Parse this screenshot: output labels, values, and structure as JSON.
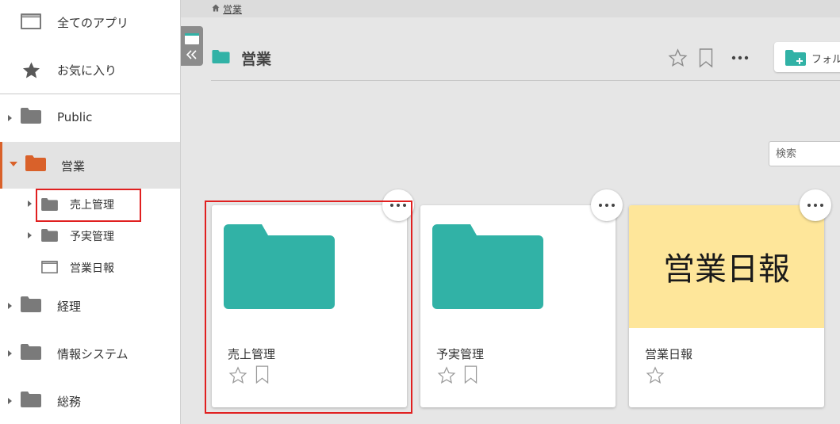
{
  "sidebar": {
    "items": [
      {
        "label": "全てのアプリ",
        "icon": "app-window-icon"
      },
      {
        "label": "お気に入り",
        "icon": "star-icon"
      },
      {
        "label": "Public",
        "icon": "folder-icon"
      },
      {
        "label": "営業",
        "icon": "folder-icon",
        "selected": true
      },
      {
        "label": "売上管理",
        "icon": "folder-icon"
      },
      {
        "label": "予実管理",
        "icon": "folder-icon"
      },
      {
        "label": "営業日報",
        "icon": "app-window-icon"
      },
      {
        "label": "経理",
        "icon": "folder-icon"
      },
      {
        "label": "情報システム",
        "icon": "folder-icon"
      },
      {
        "label": "総務",
        "icon": "folder-icon"
      }
    ]
  },
  "breadcrumb": {
    "home_icon": "home-icon",
    "current": "営業"
  },
  "header": {
    "title": "営業",
    "new_folder_label": "フォルダ"
  },
  "search": {
    "placeholder": "検索"
  },
  "cards": [
    {
      "name": "売上管理",
      "type": "folder"
    },
    {
      "name": "予実管理",
      "type": "folder"
    },
    {
      "name": "営業日報",
      "type": "app",
      "thumb_text": "営業日報"
    }
  ],
  "colors": {
    "accent": "#d9612a",
    "folder_teal": "#31b2a6",
    "folder_gray": "#7a7a7a",
    "highlight": "#e02020",
    "thumb_yellow": "#fee69a"
  }
}
